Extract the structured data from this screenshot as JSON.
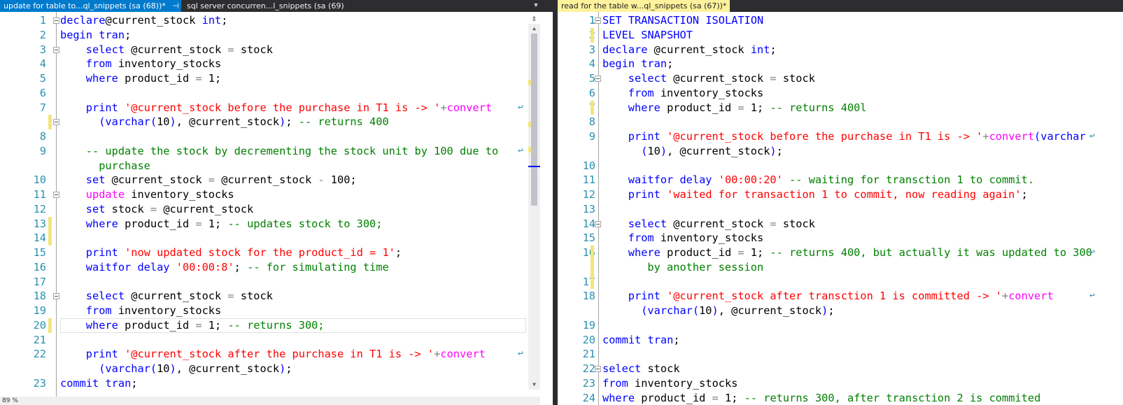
{
  "left_tabs": [
    {
      "title": "update for table to...ql_snippets (sa (68))*",
      "active": true
    },
    {
      "title": "sql server concurren...l_snippets (sa (69))*",
      "active": false
    }
  ],
  "right_tabs": [
    {
      "title": "read for the table w...ql_snippets (sa (67))*",
      "active": true
    }
  ],
  "tab_pin_glyph": "⊣",
  "tab_close_glyph": "✕",
  "zoom": "89 %",
  "left_editor": {
    "lines": [
      {
        "n": "1",
        "fold": true,
        "chg": false,
        "wrap": false,
        "indent": 0,
        "tokens": [
          [
            "kw",
            "declare"
          ],
          [
            "",
            "@current_stock "
          ],
          [
            "kw",
            "int"
          ],
          [
            "",
            ";"
          ]
        ]
      },
      {
        "n": "2",
        "fold": false,
        "chg": false,
        "wrap": false,
        "indent": 0,
        "tokens": [
          [
            "kw",
            "begin tran"
          ],
          [
            "",
            ";"
          ]
        ]
      },
      {
        "n": "3",
        "fold": true,
        "chg": false,
        "wrap": false,
        "indent": 4,
        "tokens": [
          [
            "kw",
            "select"
          ],
          [
            "",
            " @current_stock "
          ],
          [
            "op",
            "="
          ],
          [
            "",
            " stock"
          ]
        ]
      },
      {
        "n": "4",
        "fold": false,
        "chg": false,
        "wrap": false,
        "indent": 4,
        "tokens": [
          [
            "kw",
            "from"
          ],
          [
            "",
            " inventory_stocks"
          ]
        ]
      },
      {
        "n": "5",
        "fold": false,
        "chg": false,
        "wrap": false,
        "indent": 4,
        "tokens": [
          [
            "kw",
            "where"
          ],
          [
            "",
            " product_id "
          ],
          [
            "op",
            "="
          ],
          [
            "",
            " 1;"
          ]
        ]
      },
      {
        "n": "6",
        "fold": false,
        "chg": false,
        "wrap": false,
        "indent": 0,
        "tokens": []
      },
      {
        "n": "7",
        "fold": false,
        "chg": false,
        "wrap": true,
        "indent": 4,
        "tokens": [
          [
            "kw",
            "print"
          ],
          [
            "",
            " "
          ],
          [
            "str",
            "'@current_stock before the purchase in T1 is -> '"
          ],
          [
            "op",
            "+"
          ],
          [
            "fn",
            "convert"
          ]
        ]
      },
      {
        "n": "",
        "fold": true,
        "chg": true,
        "wrap": false,
        "indent": 6,
        "tokens": [
          [
            "kw",
            "("
          ],
          [
            "kw",
            "varchar"
          ],
          [
            "kw",
            "("
          ],
          [
            "",
            "10"
          ],
          [
            "kw",
            ")"
          ],
          [
            "",
            ", @current_stock"
          ],
          [
            "kw",
            ")"
          ],
          [
            "",
            "; "
          ],
          [
            "cmt",
            "-- returns 400"
          ]
        ]
      },
      {
        "n": "8",
        "fold": false,
        "chg": false,
        "wrap": false,
        "indent": 0,
        "tokens": []
      },
      {
        "n": "9",
        "fold": false,
        "chg": false,
        "wrap": true,
        "indent": 4,
        "tokens": [
          [
            "cmt",
            "-- update the stock by decrementing the stock unit by 100 due to"
          ]
        ]
      },
      {
        "n": "",
        "fold": false,
        "chg": false,
        "wrap": false,
        "indent": 6,
        "tokens": [
          [
            "cmt",
            "purchase"
          ]
        ]
      },
      {
        "n": "10",
        "fold": false,
        "chg": false,
        "wrap": false,
        "indent": 4,
        "tokens": [
          [
            "kw",
            "set"
          ],
          [
            "",
            " @current_stock "
          ],
          [
            "op",
            "="
          ],
          [
            "",
            " @current_stock "
          ],
          [
            "op",
            "-"
          ],
          [
            "",
            " 100;"
          ]
        ]
      },
      {
        "n": "11",
        "fold": true,
        "chg": false,
        "wrap": false,
        "indent": 4,
        "tokens": [
          [
            "fn",
            "update"
          ],
          [
            "",
            " inventory_stocks"
          ]
        ]
      },
      {
        "n": "12",
        "fold": false,
        "chg": false,
        "wrap": false,
        "indent": 4,
        "tokens": [
          [
            "kw",
            "set"
          ],
          [
            "",
            " stock "
          ],
          [
            "op",
            "="
          ],
          [
            "",
            " @current_stock"
          ]
        ]
      },
      {
        "n": "13",
        "fold": false,
        "chg": true,
        "wrap": false,
        "indent": 4,
        "tokens": [
          [
            "kw",
            "where"
          ],
          [
            "",
            " product_id "
          ],
          [
            "op",
            "="
          ],
          [
            "",
            " 1; "
          ],
          [
            "cmt",
            "-- updates stock to 300;"
          ]
        ]
      },
      {
        "n": "14",
        "fold": false,
        "chg": true,
        "wrap": false,
        "indent": 0,
        "tokens": []
      },
      {
        "n": "15",
        "fold": false,
        "chg": false,
        "wrap": false,
        "indent": 4,
        "tokens": [
          [
            "kw",
            "print"
          ],
          [
            "",
            " "
          ],
          [
            "str",
            "'now updated stock for the product_id = 1'"
          ],
          [
            "",
            ";"
          ]
        ]
      },
      {
        "n": "16",
        "fold": false,
        "chg": false,
        "wrap": false,
        "indent": 4,
        "tokens": [
          [
            "kw",
            "waitfor delay"
          ],
          [
            "",
            " "
          ],
          [
            "str",
            "'00:00:8'"
          ],
          [
            "",
            "; "
          ],
          [
            "cmt",
            "-- for simulating time"
          ]
        ]
      },
      {
        "n": "17",
        "fold": false,
        "chg": false,
        "wrap": false,
        "indent": 0,
        "tokens": []
      },
      {
        "n": "18",
        "fold": true,
        "chg": false,
        "wrap": false,
        "indent": 4,
        "tokens": [
          [
            "kw",
            "select"
          ],
          [
            "",
            " @current_stock "
          ],
          [
            "op",
            "="
          ],
          [
            "",
            " stock"
          ]
        ]
      },
      {
        "n": "19",
        "fold": false,
        "chg": false,
        "wrap": false,
        "indent": 4,
        "tokens": [
          [
            "kw",
            "from"
          ],
          [
            "",
            " inventory_stocks"
          ]
        ]
      },
      {
        "n": "20",
        "fold": false,
        "chg": true,
        "wrap": false,
        "indent": 4,
        "current": true,
        "tokens": [
          [
            "kw",
            "where"
          ],
          [
            "",
            " product_id "
          ],
          [
            "op",
            "="
          ],
          [
            "",
            " 1; "
          ],
          [
            "cmt",
            "-- returns 300;"
          ]
        ]
      },
      {
        "n": "21",
        "fold": false,
        "chg": false,
        "wrap": false,
        "indent": 0,
        "tokens": []
      },
      {
        "n": "22",
        "fold": false,
        "chg": false,
        "wrap": true,
        "indent": 4,
        "tokens": [
          [
            "kw",
            "print"
          ],
          [
            "",
            " "
          ],
          [
            "str",
            "'@current_stock after the purchase in T1 is -> '"
          ],
          [
            "op",
            "+"
          ],
          [
            "fn",
            "convert"
          ]
        ]
      },
      {
        "n": "",
        "fold": false,
        "chg": false,
        "wrap": false,
        "indent": 6,
        "tokens": [
          [
            "kw",
            "("
          ],
          [
            "kw",
            "varchar"
          ],
          [
            "kw",
            "("
          ],
          [
            "",
            "10"
          ],
          [
            "kw",
            ")"
          ],
          [
            "",
            ", @current_stock"
          ],
          [
            "kw",
            ")"
          ],
          [
            "",
            ";"
          ]
        ]
      },
      {
        "n": "23",
        "fold": false,
        "chg": false,
        "wrap": false,
        "indent": 0,
        "tokens": [
          [
            "kw",
            "commit tran"
          ],
          [
            "",
            ";"
          ]
        ]
      }
    ]
  },
  "right_editor": {
    "lines": [
      {
        "n": "1",
        "fold": true,
        "chg": false,
        "wrap": false,
        "indent": 0,
        "tokens": [
          [
            "kw",
            "SET TRANSACTION ISOLATION"
          ]
        ]
      },
      {
        "n": "2",
        "fold": false,
        "chg": true,
        "wrap": false,
        "indent": 0,
        "tokens": [
          [
            "kw",
            "LEVEL SNAPSHOT"
          ]
        ]
      },
      {
        "n": "3",
        "fold": false,
        "chg": false,
        "wrap": false,
        "indent": 0,
        "tokens": [
          [
            "kw",
            "declare"
          ],
          [
            "",
            " @current_stock "
          ],
          [
            "kw",
            "int"
          ],
          [
            "",
            ";"
          ]
        ]
      },
      {
        "n": "4",
        "fold": false,
        "chg": false,
        "wrap": false,
        "indent": 0,
        "tokens": [
          [
            "kw",
            "begin tran"
          ],
          [
            "",
            ";"
          ]
        ]
      },
      {
        "n": "5",
        "fold": true,
        "chg": false,
        "wrap": false,
        "indent": 4,
        "tokens": [
          [
            "kw",
            "select"
          ],
          [
            "",
            " @current_stock "
          ],
          [
            "op",
            "="
          ],
          [
            "",
            " stock"
          ]
        ]
      },
      {
        "n": "6",
        "fold": false,
        "chg": false,
        "wrap": false,
        "indent": 4,
        "tokens": [
          [
            "kw",
            "from"
          ],
          [
            "",
            " inventory_stocks"
          ]
        ]
      },
      {
        "n": "7",
        "fold": false,
        "chg": true,
        "wrap": false,
        "indent": 4,
        "tokens": [
          [
            "kw",
            "where"
          ],
          [
            "",
            " product_id "
          ],
          [
            "op",
            "="
          ],
          [
            "",
            " 1; "
          ],
          [
            "cmt",
            "-- returns 400l"
          ]
        ]
      },
      {
        "n": "8",
        "fold": false,
        "chg": false,
        "wrap": false,
        "indent": 0,
        "tokens": []
      },
      {
        "n": "9",
        "fold": false,
        "chg": false,
        "wrap": true,
        "indent": 4,
        "tokens": [
          [
            "kw",
            "print"
          ],
          [
            "",
            " "
          ],
          [
            "str",
            "'@current_stock before the purchase in T1 is -> '"
          ],
          [
            "op",
            "+"
          ],
          [
            "fn",
            "convert"
          ],
          [
            "kw",
            "(varchar"
          ]
        ]
      },
      {
        "n": "",
        "fold": false,
        "chg": false,
        "wrap": false,
        "indent": 6,
        "tokens": [
          [
            "kw",
            "("
          ],
          [
            "",
            "10"
          ],
          [
            "kw",
            ")"
          ],
          [
            "",
            ", @current_stock"
          ],
          [
            "kw",
            ")"
          ],
          [
            "",
            ";"
          ]
        ]
      },
      {
        "n": "10",
        "fold": false,
        "chg": false,
        "wrap": false,
        "indent": 0,
        "tokens": []
      },
      {
        "n": "11",
        "fold": false,
        "chg": false,
        "wrap": false,
        "indent": 4,
        "tokens": [
          [
            "kw",
            "waitfor delay"
          ],
          [
            "",
            " "
          ],
          [
            "str",
            "'00:00:20'"
          ],
          [
            "",
            " "
          ],
          [
            "cmt",
            "-- waiting for transction 1 to commit."
          ]
        ]
      },
      {
        "n": "12",
        "fold": false,
        "chg": false,
        "wrap": false,
        "indent": 4,
        "tokens": [
          [
            "kw",
            "print"
          ],
          [
            "",
            " "
          ],
          [
            "str",
            "'waited for transaction 1 to commit, now reading again'"
          ],
          [
            "",
            ";"
          ]
        ]
      },
      {
        "n": "13",
        "fold": false,
        "chg": false,
        "wrap": false,
        "indent": 0,
        "tokens": []
      },
      {
        "n": "14",
        "fold": true,
        "chg": false,
        "wrap": false,
        "indent": 4,
        "tokens": [
          [
            "kw",
            "select"
          ],
          [
            "",
            " @current_stock "
          ],
          [
            "op",
            "="
          ],
          [
            "",
            " stock"
          ]
        ]
      },
      {
        "n": "15",
        "fold": false,
        "chg": false,
        "wrap": false,
        "indent": 4,
        "tokens": [
          [
            "kw",
            "from"
          ],
          [
            "",
            " inventory_stocks"
          ]
        ]
      },
      {
        "n": "16",
        "fold": false,
        "chg": true,
        "wrap": true,
        "indent": 4,
        "tokens": [
          [
            "kw",
            "where"
          ],
          [
            "",
            " product_id "
          ],
          [
            "op",
            "="
          ],
          [
            "",
            " 1; "
          ],
          [
            "cmt",
            "-- returns 400, but actually it was updated to 300"
          ]
        ]
      },
      {
        "n": "",
        "fold": false,
        "chg": true,
        "wrap": false,
        "indent": 7,
        "tokens": [
          [
            "cmt",
            "by another session"
          ]
        ]
      },
      {
        "n": "17",
        "fold": false,
        "chg": true,
        "wrap": false,
        "indent": 0,
        "tokens": []
      },
      {
        "n": "18",
        "fold": false,
        "chg": false,
        "wrap": true,
        "indent": 4,
        "tokens": [
          [
            "kw",
            "print"
          ],
          [
            "",
            " "
          ],
          [
            "str",
            "'@current_stock after transction 1 is committed -> '"
          ],
          [
            "op",
            "+"
          ],
          [
            "fn",
            "convert"
          ]
        ]
      },
      {
        "n": "",
        "fold": false,
        "chg": false,
        "wrap": false,
        "indent": 6,
        "tokens": [
          [
            "kw",
            "("
          ],
          [
            "kw",
            "varchar"
          ],
          [
            "kw",
            "("
          ],
          [
            "",
            "10"
          ],
          [
            "kw",
            ")"
          ],
          [
            "",
            ", @current_stock"
          ],
          [
            "kw",
            ")"
          ],
          [
            "",
            ";"
          ]
        ]
      },
      {
        "n": "19",
        "fold": false,
        "chg": false,
        "wrap": false,
        "indent": 0,
        "tokens": []
      },
      {
        "n": "20",
        "fold": false,
        "chg": false,
        "wrap": false,
        "indent": 0,
        "tokens": [
          [
            "kw",
            "commit tran"
          ],
          [
            "",
            ";"
          ]
        ]
      },
      {
        "n": "21",
        "fold": false,
        "chg": false,
        "wrap": false,
        "indent": 0,
        "tokens": []
      },
      {
        "n": "22",
        "fold": true,
        "chg": false,
        "wrap": false,
        "indent": 0,
        "tokens": [
          [
            "kw",
            "select"
          ],
          [
            "",
            " stock"
          ]
        ]
      },
      {
        "n": "23",
        "fold": false,
        "chg": false,
        "wrap": false,
        "indent": 0,
        "tokens": [
          [
            "kw",
            "from"
          ],
          [
            "",
            " inventory_stocks"
          ]
        ]
      },
      {
        "n": "24",
        "fold": false,
        "chg": false,
        "wrap": false,
        "indent": 0,
        "tokens": [
          [
            "kw",
            "where"
          ],
          [
            "",
            " product_id "
          ],
          [
            "op",
            "="
          ],
          [
            "",
            " 1; "
          ],
          [
            "cmt",
            "-- returns 300, after transction 2 is commited"
          ]
        ]
      }
    ]
  },
  "colors": {
    "keyword": "#0000ff",
    "string": "#ff0000",
    "comment": "#008000",
    "function": "#ff00ff",
    "line_number": "#2b91af",
    "changed_line_marker": "#f3e57c",
    "active_tab_left": "#007acc",
    "active_tab_right": "#fff29d"
  },
  "icons": {
    "wrap": "word-wrap-icon",
    "fold": "fold-collapse-icon",
    "pin": "pin-icon",
    "close": "close-icon"
  }
}
